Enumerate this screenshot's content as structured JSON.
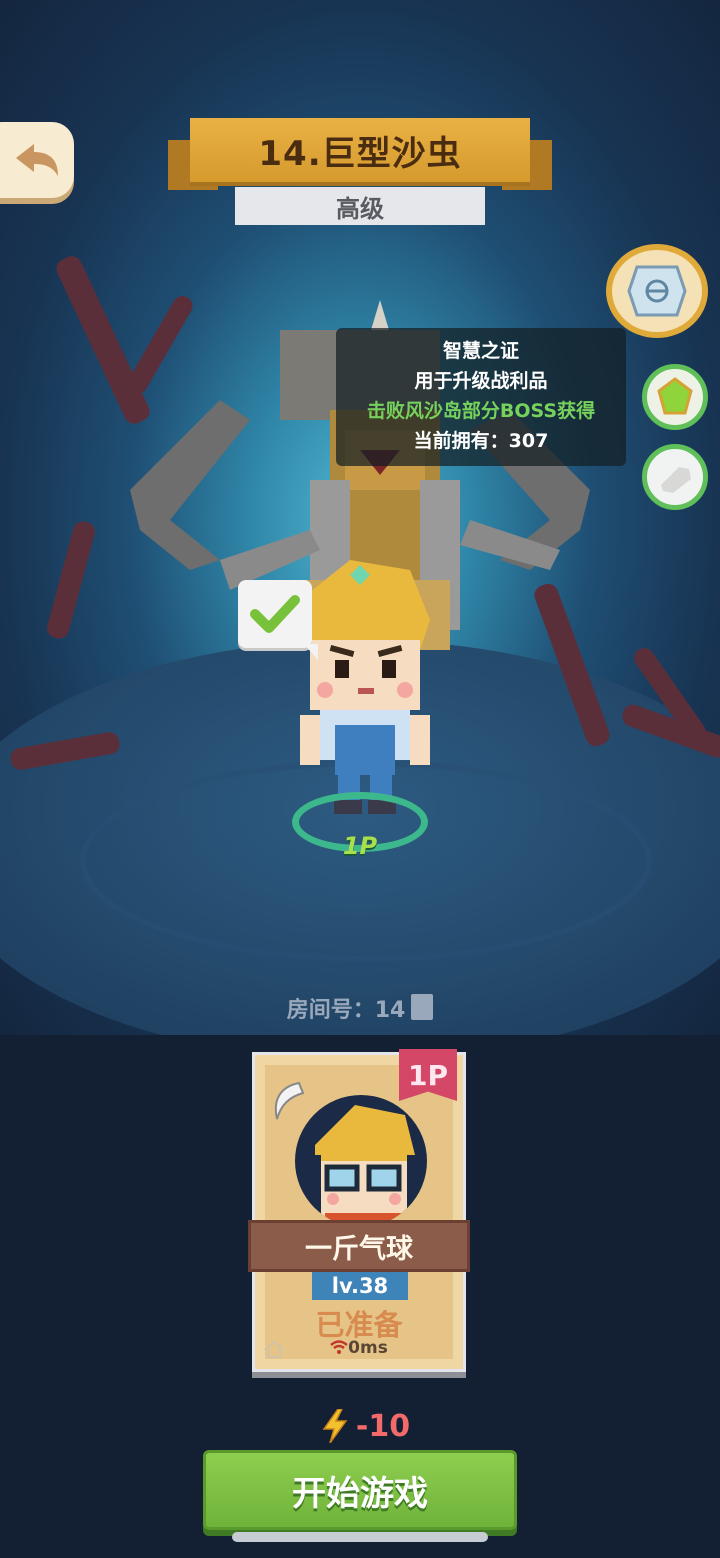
{
  "header": {
    "level_title": "14.巨型沙虫",
    "difficulty": "高级"
  },
  "tooltip": {
    "item_name": "智慧之证",
    "item_use": "用于升级战利品",
    "item_source": "击败风沙岛部分BOSS获得",
    "item_owned": "当前拥有：307"
  },
  "scene": {
    "player_tag": "1P"
  },
  "room": {
    "label": "房间号：14"
  },
  "player_card": {
    "badge": "1P",
    "name": "一斤气球",
    "level": "lv.38",
    "status": "已准备",
    "ping": "0ms"
  },
  "footer": {
    "energy_cost": "-10",
    "start_label": "开始游戏"
  },
  "colors": {
    "title_gold": "#e9b144",
    "start_green": "#7ec044",
    "ready_orange": "#d88b4f",
    "tooltip_green": "#76d25c"
  }
}
